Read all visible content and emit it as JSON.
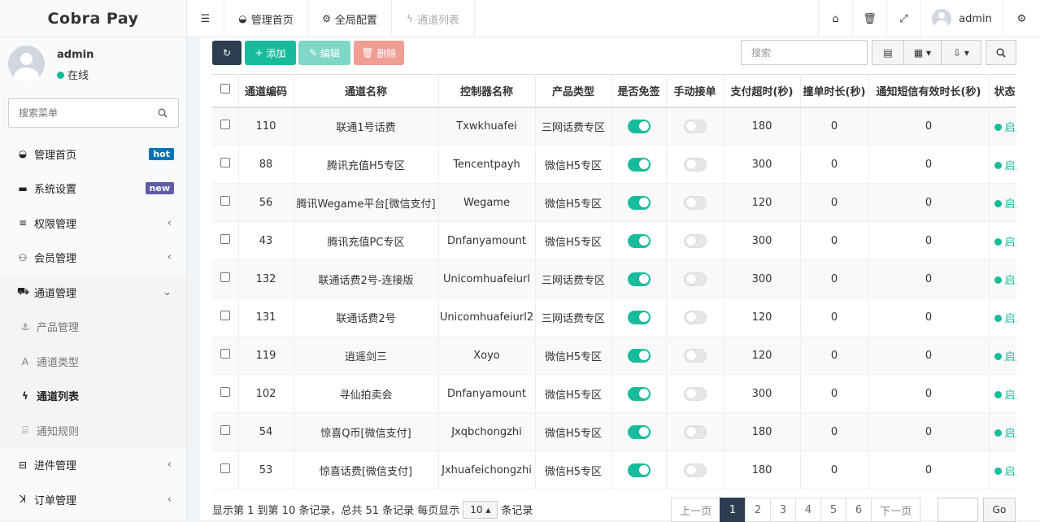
{
  "app": {
    "logo": "Cobra Pay"
  },
  "user": {
    "name": "admin",
    "status": "在线"
  },
  "sidebar": {
    "search_placeholder": "搜索菜单",
    "items": [
      {
        "label": "管理首页",
        "icon": "dashboard-icon",
        "badge": "hot",
        "badge_color": "#0073b7"
      },
      {
        "label": "系统设置",
        "icon": "folder-icon",
        "badge": "new",
        "badge_color": "#605ca8"
      },
      {
        "label": "权限管理",
        "icon": "list-icon"
      },
      {
        "label": "会员管理",
        "icon": "user-plus-icon"
      },
      {
        "label": "通道管理",
        "icon": "cart-icon",
        "open": true
      },
      {
        "label": "产品管理",
        "icon": "product-icon",
        "sub": true
      },
      {
        "label": "通道类型",
        "icon": "type-icon",
        "sub": true
      },
      {
        "label": "通道列表",
        "icon": "flash-icon",
        "sub": true,
        "active": true
      },
      {
        "label": "通知规则",
        "icon": "notify-icon",
        "sub": true
      },
      {
        "label": "进件管理",
        "icon": "file-icon"
      },
      {
        "label": "订单管理",
        "icon": "order-icon"
      }
    ]
  },
  "topbar": {
    "tabs": [
      {
        "label": "管理首页",
        "icon": "dashboard-icon"
      },
      {
        "label": "全局配置",
        "icon": "cogs-icon"
      },
      {
        "label": "通道列表",
        "icon": "flash-icon",
        "dim": true
      }
    ],
    "user": "admin"
  },
  "toolbar": {
    "add": "添加",
    "edit": "编辑",
    "delete": "删除",
    "search_placeholder": "搜索"
  },
  "table": {
    "headers": [
      "通道编码",
      "通道名称",
      "控制器名称",
      "产品类型",
      "是否免签",
      "手动接单",
      "支付超时(秒)",
      "撞单时长(秒)",
      "通知短信有效时长(秒)",
      "状态"
    ],
    "rows": [
      {
        "code": "110",
        "name": "联通1号话费",
        "ctrl": "Txwkhuafei",
        "type": "三网话费专区",
        "free": true,
        "manual": false,
        "timeout": "180",
        "collide": "0",
        "sms": "0",
        "status": "启用"
      },
      {
        "code": "88",
        "name": "腾讯充值H5专区",
        "ctrl": "Tencentpayh",
        "type": "微信H5专区",
        "free": true,
        "manual": false,
        "timeout": "300",
        "collide": "0",
        "sms": "0",
        "status": "启用"
      },
      {
        "code": "56",
        "name": "腾讯Wegame平台[微信支付]",
        "ctrl": "Wegame",
        "type": "微信H5专区",
        "free": true,
        "manual": false,
        "timeout": "120",
        "collide": "0",
        "sms": "0",
        "status": "启用"
      },
      {
        "code": "43",
        "name": "腾讯充值PC专区",
        "ctrl": "Dnfanyamount",
        "type": "微信H5专区",
        "free": true,
        "manual": false,
        "timeout": "300",
        "collide": "0",
        "sms": "0",
        "status": "启用"
      },
      {
        "code": "132",
        "name": "联通话费2号-连接版",
        "ctrl": "Unicomhuafeiurl",
        "type": "三网话费专区",
        "free": true,
        "manual": false,
        "timeout": "300",
        "collide": "0",
        "sms": "0",
        "status": "启用"
      },
      {
        "code": "131",
        "name": "联通话费2号",
        "ctrl": "Unicomhuafeiurl2",
        "type": "三网话费专区",
        "free": true,
        "manual": false,
        "timeout": "120",
        "collide": "0",
        "sms": "0",
        "status": "启用"
      },
      {
        "code": "119",
        "name": "逍遥剑三",
        "ctrl": "Xoyo",
        "type": "微信H5专区",
        "free": true,
        "manual": false,
        "timeout": "120",
        "collide": "0",
        "sms": "0",
        "status": "启用"
      },
      {
        "code": "102",
        "name": "寻仙拍卖会",
        "ctrl": "Dnfanyamount",
        "type": "微信H5专区",
        "free": true,
        "manual": false,
        "timeout": "300",
        "collide": "0",
        "sms": "0",
        "status": "启用"
      },
      {
        "code": "54",
        "name": "惊喜Q币[微信支付]",
        "ctrl": "Jxqbchongzhi",
        "type": "微信H5专区",
        "free": true,
        "manual": false,
        "timeout": "180",
        "collide": "0",
        "sms": "0",
        "status": "启用"
      },
      {
        "code": "53",
        "name": "惊喜话费[微信支付]",
        "ctrl": "Jxhuafeichongzhi",
        "type": "微信H5专区",
        "free": true,
        "manual": false,
        "timeout": "180",
        "collide": "0",
        "sms": "0",
        "status": "启用"
      }
    ]
  },
  "footer": {
    "summary": "显示第 1 到第 10 条记录，总共 51 条记录 每页显示",
    "per_page": "10",
    "suffix": "条记录",
    "pages": [
      "上一页",
      "1",
      "2",
      "3",
      "4",
      "5",
      "6",
      "下一页"
    ],
    "active_page": "1",
    "go": "Go"
  },
  "colors": {
    "success": "#18bc9c",
    "primary_dark": "#2c3e50",
    "danger": "#e74c3c"
  }
}
